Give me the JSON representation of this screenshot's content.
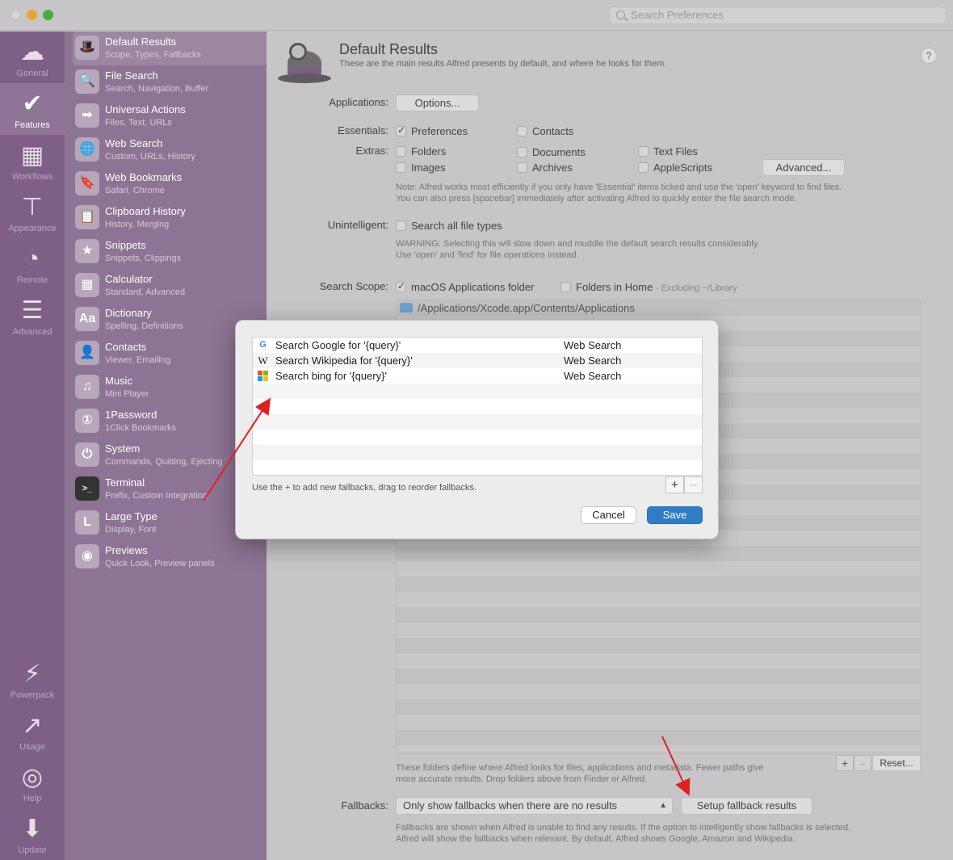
{
  "titlebar": {
    "search_placeholder": "Search Preferences"
  },
  "rail": [
    {
      "label": "General",
      "icon": "hat-icon"
    },
    {
      "label": "Features",
      "icon": "checkmark-icon"
    },
    {
      "label": "Workflows",
      "icon": "grid-icon"
    },
    {
      "label": "Appearance",
      "icon": "paint-roller-icon"
    },
    {
      "label": "Remote",
      "icon": "remote-icon"
    },
    {
      "label": "Advanced",
      "icon": "sliders-icon"
    },
    {
      "label": "Powerpack",
      "icon": "battery-icon"
    },
    {
      "label": "Usage",
      "icon": "chart-icon"
    },
    {
      "label": "Help",
      "icon": "lifebuoy-icon"
    },
    {
      "label": "Update",
      "icon": "download-icon"
    }
  ],
  "features": [
    {
      "title": "Default Results",
      "sub": "Scope, Types, Fallbacks",
      "glyph": "🎩"
    },
    {
      "title": "File Search",
      "sub": "Search, Navigation, Buffer",
      "glyph": "🔍"
    },
    {
      "title": "Universal Actions",
      "sub": "Files, Text, URLs",
      "glyph": "➡"
    },
    {
      "title": "Web Search",
      "sub": "Custom, URLs, History",
      "glyph": "🌐"
    },
    {
      "title": "Web Bookmarks",
      "sub": "Safari, Chrome",
      "glyph": "🔖"
    },
    {
      "title": "Clipboard History",
      "sub": "History, Merging",
      "glyph": "📋"
    },
    {
      "title": "Snippets",
      "sub": "Snippets, Clippings",
      "glyph": "★"
    },
    {
      "title": "Calculator",
      "sub": "Standard, Advanced",
      "glyph": "▦"
    },
    {
      "title": "Dictionary",
      "sub": "Spelling, Definitions",
      "glyph": "Aa"
    },
    {
      "title": "Contacts",
      "sub": "Viewer, Emailing",
      "glyph": "👤"
    },
    {
      "title": "Music",
      "sub": "Mini Player",
      "glyph": "♫"
    },
    {
      "title": "1Password",
      "sub": "1Click Bookmarks",
      "glyph": "①"
    },
    {
      "title": "System",
      "sub": "Commands, Quitting, Ejecting",
      "glyph": "⏻"
    },
    {
      "title": "Terminal",
      "sub": "Prefix, Custom Integration",
      "glyph": ">_"
    },
    {
      "title": "Large Type",
      "sub": "Display, Font",
      "glyph": "L"
    },
    {
      "title": "Previews",
      "sub": "Quick Look, Preview panels",
      "glyph": "◉"
    }
  ],
  "main": {
    "title": "Default Results",
    "subtitle": "These are the main results Alfred presents by default, and where he looks for them.",
    "help": "?",
    "applications_label": "Applications:",
    "options_button": "Options...",
    "essentials_label": "Essentials:",
    "extras_label": "Extras:",
    "essentials": [
      {
        "label": "Preferences",
        "checked": true
      },
      {
        "label": "Contacts",
        "checked": false
      }
    ],
    "extras": [
      {
        "label": "Folders",
        "checked": false
      },
      {
        "label": "Documents",
        "checked": false
      },
      {
        "label": "Text Files",
        "checked": false
      },
      {
        "label": "Images",
        "checked": false
      },
      {
        "label": "Archives",
        "checked": false
      },
      {
        "label": "AppleScripts",
        "checked": false
      }
    ],
    "advanced_button": "Advanced...",
    "note_line1": "Note: Alfred works most efficiently if you only have 'Essential' items ticked and use the 'open' keyword to find files.",
    "note_line2": "You can also press [spacebar] immediately after activating Alfred to quickly enter the file search mode.",
    "unintelligent_label": "Unintelligent:",
    "search_all_label": "Search all file types",
    "warning_line1": "WARNING: Selecting this will slow down and muddle the default search results considerably.",
    "warning_line2": "Use 'open' and 'find' for file operations instead.",
    "scope_label": "Search Scope:",
    "scope_apps": "macOS Applications folder",
    "scope_home": "Folders in Home",
    "scope_home_extra": "- Excluding ~/Library",
    "folders": [
      "/Applications/Xcode.app/Contents/Applications"
    ],
    "plus": "+",
    "minus": "–",
    "reset_button": "Reset...",
    "folders_note_line1": "These folders define where Alfred looks for files, applications and metadata. Fewer paths give",
    "folders_note_line2": "more accurate results. Drop folders above from Finder or Alfred.",
    "fallbacks_label": "Fallbacks:",
    "fallbacks_select": "Only show fallbacks when there are no results",
    "setup_fallback_button": "Setup fallback results",
    "fallbacks_note_line1": "Fallbacks are shown when Alfred is unable to find any results. If the option to intelligently show fallbacks is selected,",
    "fallbacks_note_line2": "Alfred will show the fallbacks when relevant. By default, Alfred shows Google, Amazon and Wikipedia."
  },
  "dialog": {
    "rows": [
      {
        "name": "Search Google for '{query}'",
        "type": "Web Search",
        "icon": "google-icon"
      },
      {
        "name": "Search Wikipedia for '{query}'",
        "type": "Web Search",
        "icon": "wikipedia-icon"
      },
      {
        "name": "Search bing for '{query}'",
        "type": "Web Search",
        "icon": "bing-icon"
      }
    ],
    "hint": "Use the + to add new fallbacks, drag to reorder fallbacks.",
    "plus": "+",
    "minus": "–",
    "cancel": "Cancel",
    "save": "Save"
  },
  "colors": {
    "rail": "#7e5f86",
    "list": "#8e7494",
    "save": "#2f7dc6",
    "arrow": "#e02020"
  }
}
